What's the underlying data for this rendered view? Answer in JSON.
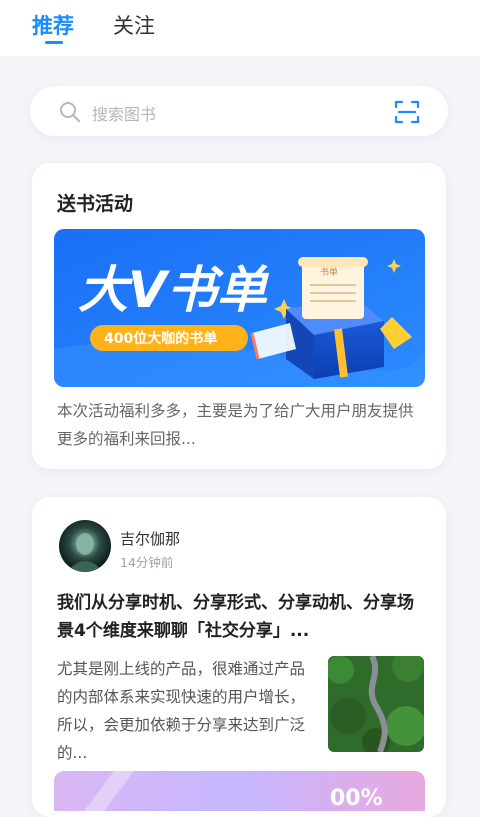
{
  "tabs": [
    {
      "label": "推荐"
    },
    {
      "label": "关注"
    }
  ],
  "search": {
    "placeholder": "搜索图书"
  },
  "activity_card": {
    "title": "送书活动",
    "banner_title": "大V书单",
    "banner_badge": "400位大咖的书单",
    "banner_scroll_text": "书单",
    "description": "本次活动福利多多，主要是为了给广大用户朋友提供更多的福利来回报..."
  },
  "post_card": {
    "username": "吉尔伽那",
    "time": "14分钟前",
    "title": "我们从分享时机、分享形式、分享动机、分享场景4个维度来聊聊「社交分享」...",
    "description": "尤其是刚上线的产品，很难通过产品的内部体系来实现快速的用户增长，所以，会更加依赖于分享来达到广泛的...",
    "bottom_banner_text": "00%"
  },
  "colors": {
    "accent": "#1a8cff",
    "background": "#f3f5f8",
    "banner_blue": "#1f6cf2",
    "badge_orange": "#ffb21a"
  }
}
